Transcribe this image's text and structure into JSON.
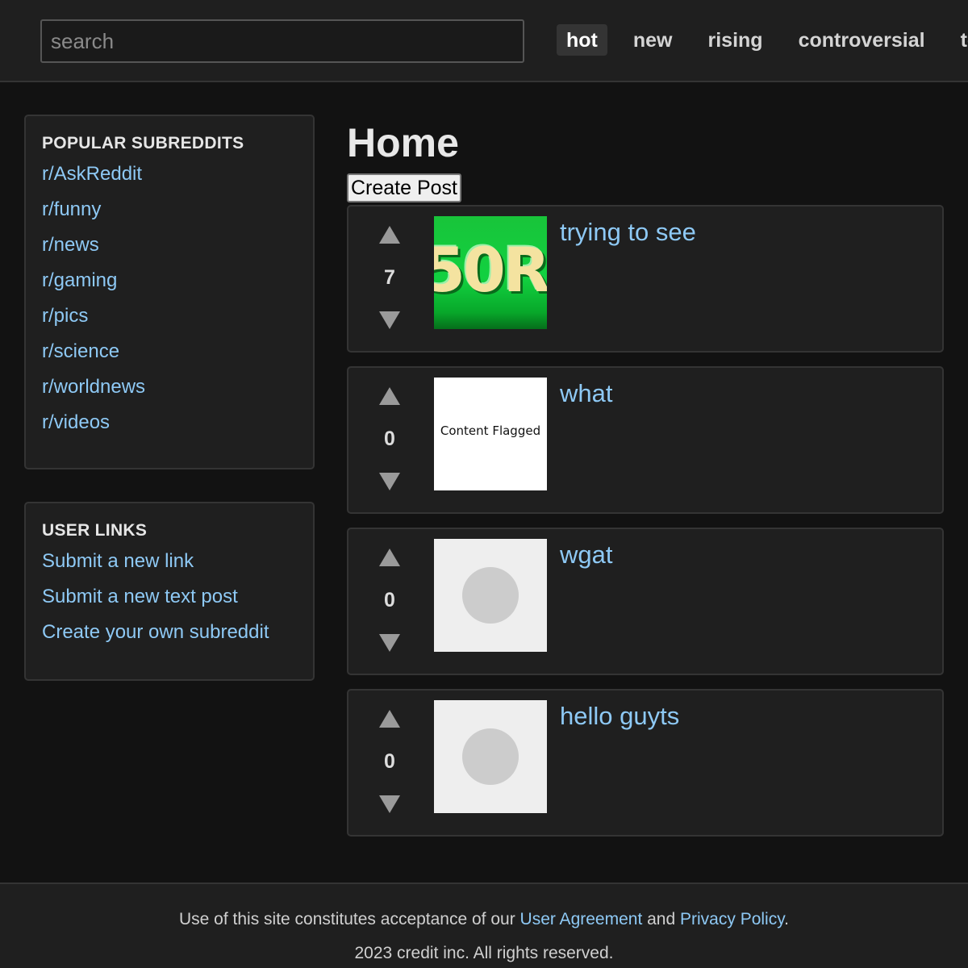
{
  "header": {
    "search_placeholder": "search",
    "sort_tabs": [
      {
        "label": "hot",
        "active": true
      },
      {
        "label": "new",
        "active": false
      },
      {
        "label": "rising",
        "active": false
      },
      {
        "label": "controversial",
        "active": false
      },
      {
        "label": "top",
        "active": false
      }
    ]
  },
  "sidebar": {
    "popular": {
      "title": "POPULAR SUBREDDITS",
      "links": [
        "r/AskReddit",
        "r/funny",
        "r/news",
        "r/gaming",
        "r/pics",
        "r/science",
        "r/worldnews",
        "r/videos"
      ]
    },
    "user_links": {
      "title": "USER LINKS",
      "links": [
        "Submit a new link",
        "Submit a new text post",
        "Create your own subreddit"
      ]
    }
  },
  "main": {
    "title": "Home",
    "create_post_label": "Create Post",
    "posts": [
      {
        "title": "trying to see",
        "score": "7",
        "thumb_type": "green",
        "thumb_text": "50R"
      },
      {
        "title": "what",
        "score": "0",
        "thumb_type": "flagged",
        "thumb_text": "Content Flagged"
      },
      {
        "title": "wgat",
        "score": "0",
        "thumb_type": "placeholder",
        "thumb_text": ""
      },
      {
        "title": "hello guyts",
        "score": "0",
        "thumb_type": "placeholder",
        "thumb_text": ""
      }
    ]
  },
  "footer": {
    "line1_prefix": "Use of this site constitutes acceptance of our ",
    "user_agreement": "User Agreement",
    "line1_and": " and ",
    "privacy_policy": "Privacy Policy",
    "line1_suffix": ".",
    "line2": "2023 credit inc. All rights reserved."
  },
  "colors": {
    "background": "#121212",
    "panel": "#1f1f1f",
    "border": "#343434",
    "link": "#8ec9f5"
  }
}
